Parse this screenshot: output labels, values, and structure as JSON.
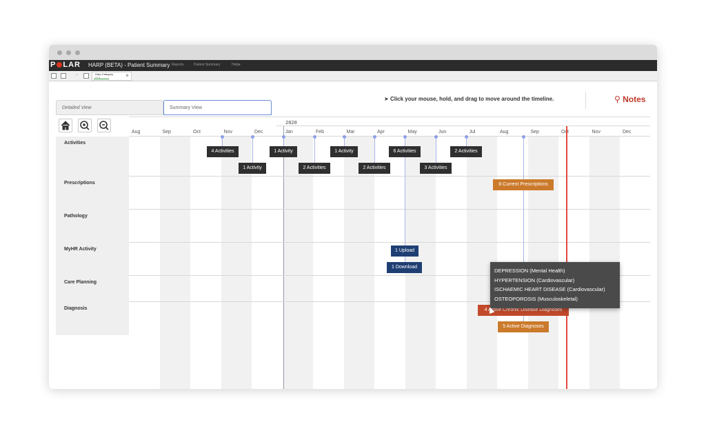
{
  "app": {
    "logo": "POLAR",
    "title": "HARP (BETA) - Patient Summary",
    "menu": [
      "Reports",
      "Patient Summary",
      "Help"
    ]
  },
  "sheet_chip": {
    "title": "Harp Category",
    "subtitle": "sheet"
  },
  "view_tabs": {
    "detailed": "Detailed View",
    "summary": "Summary View"
  },
  "instruction": "Click your mouse, hold, and drag to move around the timeline.",
  "notes_label": "Notes",
  "toolbar_icons": [
    "home-icon",
    "zoom-in-icon",
    "zoom-out-icon"
  ],
  "timeline": {
    "year_label": "2020",
    "months": [
      "Aug",
      "Sep",
      "Oct",
      "Nov",
      "Dec",
      "Jan",
      "Feb",
      "Mar",
      "Apr",
      "May",
      "Jun",
      "Jul",
      "Aug",
      "Sep",
      "Oct",
      "Nov",
      "Dec"
    ]
  },
  "rows": [
    "Activities",
    "Prescriptions",
    "Pathology",
    "MyHR Activity",
    "Care Planning",
    "Diagnosis"
  ],
  "events": {
    "activities": [
      "4 Activities",
      "1 Activity",
      "1 Activity",
      "2 Activities",
      "1 Activity",
      "2 Activities",
      "6 Activities",
      "3 Activities",
      "2 Activities"
    ],
    "prescriptions": [
      "8 Current Prescriptions"
    ],
    "myhr": [
      "1 Upload",
      "1 Download"
    ],
    "diagnosis": [
      "4 Active Chronic Disease Diagnoses",
      "5 Active Diagnoses"
    ]
  },
  "tooltip": [
    "DEPRESSION (Mental Health)",
    "HYPERTENSION (Cardiovascular)",
    "ISCHAEMIC HEART DISEASE (Cardiovascular)",
    "OSTEOPOROSIS (Musculoskeletal)"
  ],
  "colors": {
    "accent_red": "#c0392b",
    "tag_dark": "#2f2f2f",
    "tag_navy": "#1f3f73",
    "tag_orange": "#cb7a2b",
    "tag_red": "#c24a2a",
    "today_line": "#e24a3b"
  }
}
